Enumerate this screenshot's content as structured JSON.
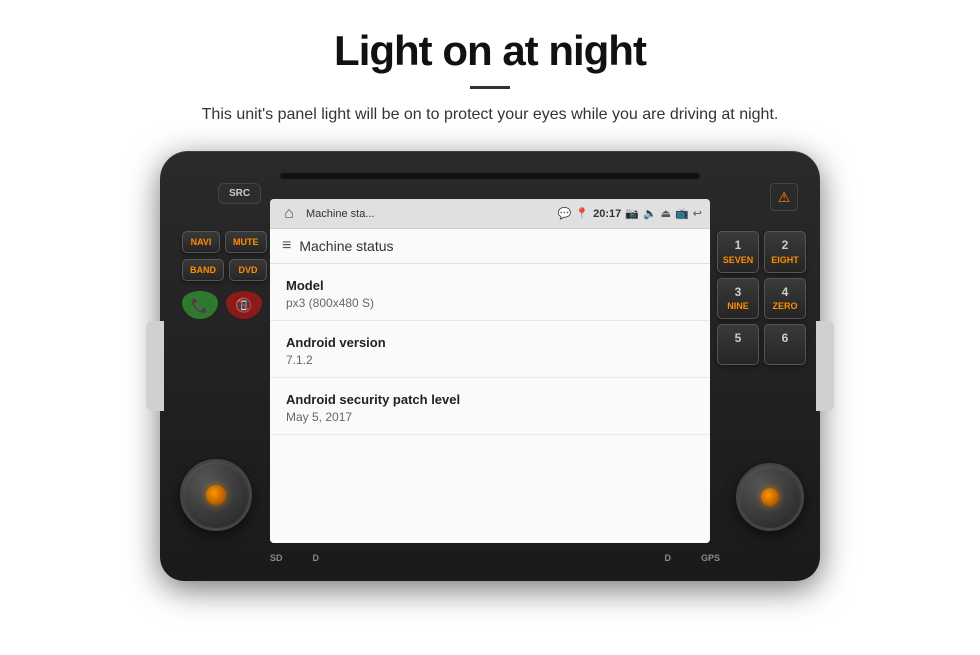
{
  "header": {
    "title": "Light on at night",
    "description": "This unit's panel light will be on to protect your eyes while you are driving at night."
  },
  "unit": {
    "buttons": {
      "src": "SRC",
      "navi": "NAVI",
      "mute": "MUTE",
      "band": "BAND",
      "dvd": "DVD"
    },
    "numpad": [
      {
        "label": "SEVEN",
        "num": "1"
      },
      {
        "label": "EIGHT",
        "num": "2"
      },
      {
        "label": "NINE",
        "num": "3"
      },
      {
        "label": "ZERO",
        "num": "4"
      },
      {
        "label": "5",
        "num": "5"
      },
      {
        "label": "6",
        "num": "6"
      }
    ]
  },
  "android": {
    "statusbar": {
      "appname": "Machine sta...",
      "time": "20:17"
    },
    "screen": {
      "toolbar_title": "Machine status",
      "rows": [
        {
          "label": "Model",
          "value": "px3 (800x480 S)"
        },
        {
          "label": "Android version",
          "value": "7.1.2"
        },
        {
          "label": "Android security patch level",
          "value": "May 5, 2017"
        }
      ]
    }
  },
  "ports": {
    "left": [
      "SD",
      "D"
    ],
    "right": [
      "D",
      "GPS"
    ]
  }
}
